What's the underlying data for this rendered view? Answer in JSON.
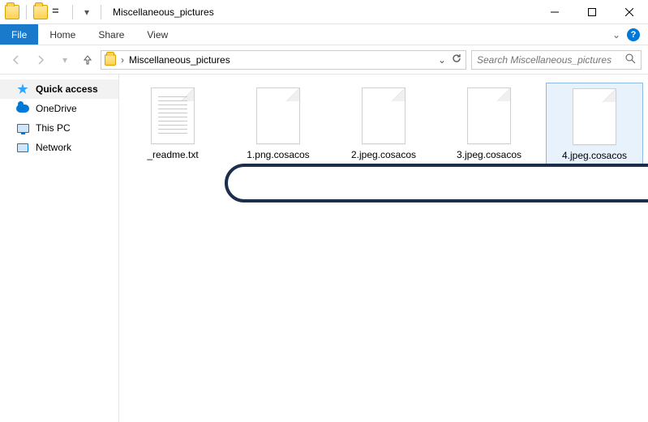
{
  "window": {
    "title": "Miscellaneous_pictures"
  },
  "ribbon": {
    "file_label": "File",
    "tabs": [
      "Home",
      "Share",
      "View"
    ]
  },
  "address": {
    "crumb": "Miscellaneous_pictures"
  },
  "search": {
    "placeholder": "Search Miscellaneous_pictures"
  },
  "sidebar": {
    "items": [
      {
        "label": "Quick access",
        "icon": "star"
      },
      {
        "label": "OneDrive",
        "icon": "cloud"
      },
      {
        "label": "This PC",
        "icon": "pc"
      },
      {
        "label": "Network",
        "icon": "net"
      }
    ]
  },
  "files": [
    {
      "name": "_readme.txt",
      "kind": "text",
      "selected": false
    },
    {
      "name": "1.png.cosacos",
      "kind": "blank",
      "selected": false
    },
    {
      "name": "2.jpeg.cosacos",
      "kind": "blank",
      "selected": false
    },
    {
      "name": "3.jpeg.cosacos",
      "kind": "blank",
      "selected": false
    },
    {
      "name": "4.jpeg.cosacos",
      "kind": "blank",
      "selected": true
    }
  ]
}
